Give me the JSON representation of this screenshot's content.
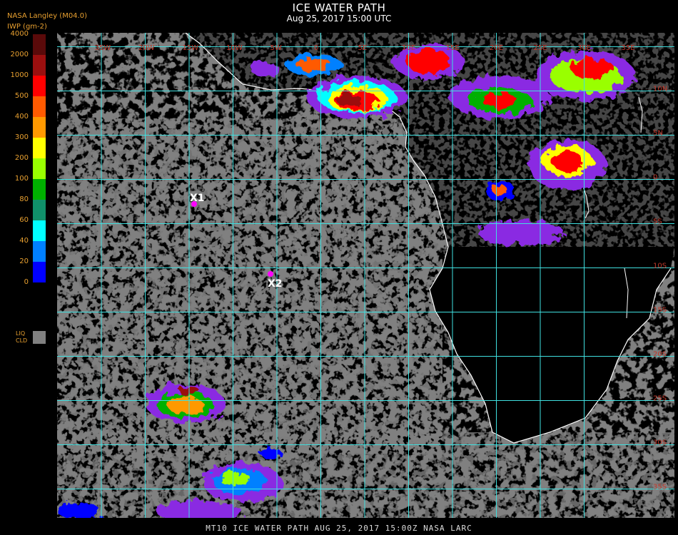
{
  "header": {
    "title": "ICE WATER PATH",
    "subtitle": "Aug 25, 2017 15:00 UTC",
    "source": "NASA Langley (M04.0)",
    "units": "IWP (gm-2)"
  },
  "legend": {
    "levels": [
      {
        "label": "4000",
        "color": "#5a0a0a"
      },
      {
        "label": "2000",
        "color": "#9b0f0f"
      },
      {
        "label": "1000",
        "color": "#ff0000"
      },
      {
        "label": "500",
        "color": "#ff5a00"
      },
      {
        "label": "400",
        "color": "#ff9900"
      },
      {
        "label": "300",
        "color": "#ffff00"
      },
      {
        "label": "200",
        "color": "#99ff00"
      },
      {
        "label": "100",
        "color": "#00b000"
      },
      {
        "label": "80",
        "color": "#10906a"
      },
      {
        "label": "60",
        "color": "#00ffff"
      },
      {
        "label": "40",
        "color": "#0080ff"
      },
      {
        "label": "20",
        "color": "#0000ff"
      },
      {
        "label": "0",
        "color": "#8a2be2"
      }
    ],
    "liquid_label_1": "LIQ",
    "liquid_label_2": "CLD",
    "liquid_color": "#808080"
  },
  "map": {
    "longitude_labels": [
      "35W",
      "20W",
      "15W",
      "10W",
      "5W",
      "0",
      "5E",
      "10E",
      "15E",
      "20E",
      "25E",
      "30E",
      "35E"
    ],
    "latitude_labels": [
      "10N",
      "5N",
      "0",
      "5S",
      "10S",
      "15S",
      "20S",
      "25S",
      "30S",
      "35S",
      "40S"
    ],
    "markers": [
      {
        "label": "X1",
        "color": "#ff00ff"
      },
      {
        "label": "X2",
        "color": "#ff00ff"
      }
    ],
    "grid_color": "#40e0e0",
    "coast_color": "#ffffff",
    "ocean_color": "#000000",
    "cloud_color": "#808080"
  },
  "footer": {
    "text": "MT10  ICE WATER PATH   AUG 25, 2017 15:00Z   NASA LARC"
  }
}
